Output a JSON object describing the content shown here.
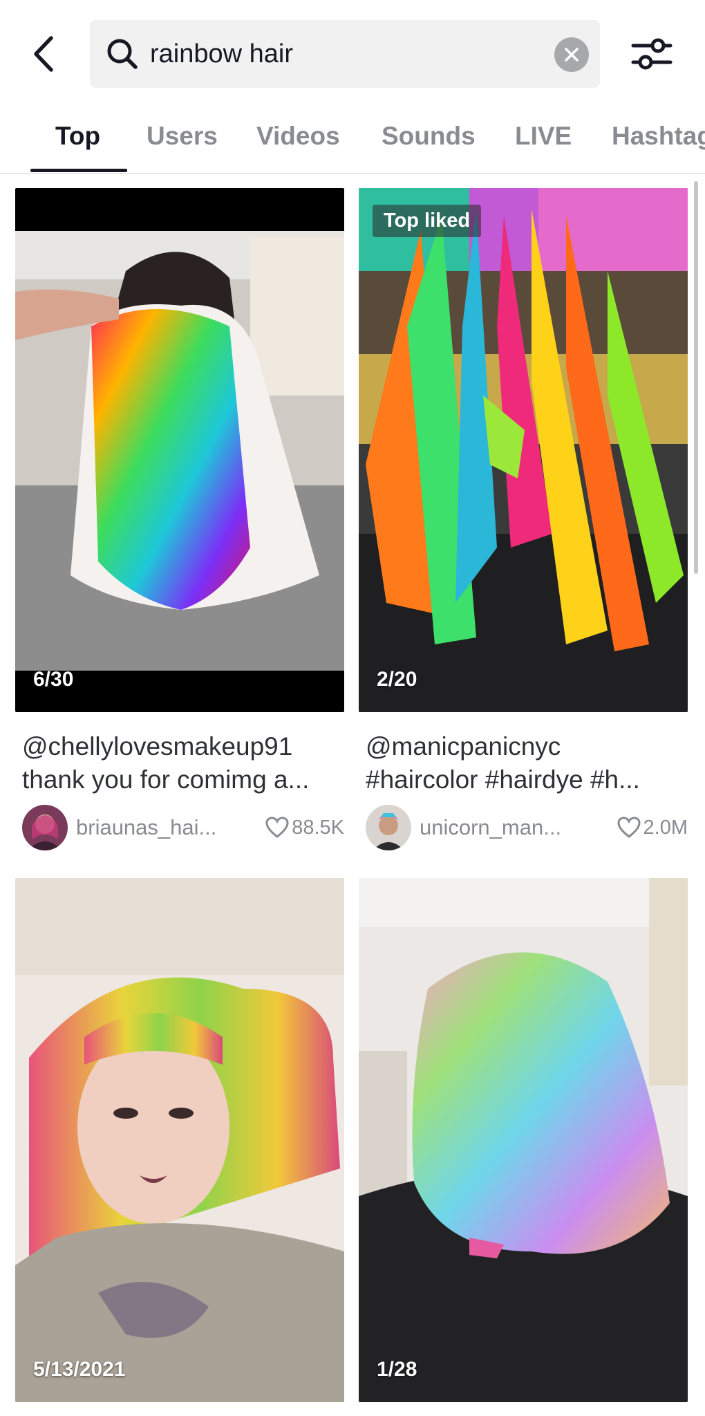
{
  "header": {
    "back_icon": "chevron-left-icon",
    "search_icon": "search-icon",
    "search_value": "rainbow hair",
    "clear_icon": "close-icon",
    "filter_icon": "sliders-icon"
  },
  "tabs": [
    {
      "label": "Top",
      "active": true
    },
    {
      "label": "Users",
      "active": false
    },
    {
      "label": "Videos",
      "active": false
    },
    {
      "label": "Sounds",
      "active": false
    },
    {
      "label": "LIVE",
      "active": false
    },
    {
      "label": "Hashtags",
      "active": false
    }
  ],
  "results": [
    {
      "count": "6/30",
      "badge": "",
      "caption_line1": "@chellylovesmakeup91",
      "caption_line2": "thank you for comimg a...",
      "author": "briaunas_hai...",
      "likes": "88.5K"
    },
    {
      "count": "2/20",
      "badge": "Top liked",
      "caption_line1": "@manicpanicnyc",
      "caption_line2": "#haircolor #hairdye #h...",
      "author": "unicorn_man...",
      "likes": "2.0M"
    },
    {
      "count": "5/13/2021",
      "badge": ""
    },
    {
      "count": "1/28",
      "badge": ""
    }
  ],
  "colors": {
    "text_primary": "#161823",
    "text_secondary": "#8a8b91",
    "search_bg": "#f1f1f2"
  }
}
